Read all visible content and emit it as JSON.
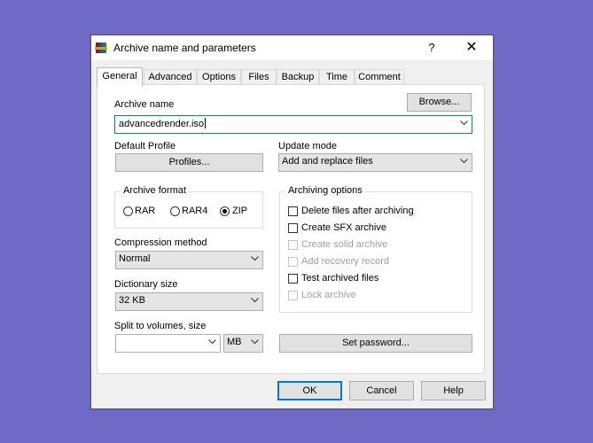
{
  "window": {
    "title": "Archive name and parameters",
    "help_label": "?",
    "close_label": "✕"
  },
  "tabs": [
    {
      "label": "General",
      "active": true
    },
    {
      "label": "Advanced",
      "active": false
    },
    {
      "label": "Options",
      "active": false
    },
    {
      "label": "Files",
      "active": false
    },
    {
      "label": "Backup",
      "active": false
    },
    {
      "label": "Time",
      "active": false
    },
    {
      "label": "Comment",
      "active": false
    }
  ],
  "general": {
    "archive_name_label": "Archive name",
    "browse_label": "Browse...",
    "archive_name_value": "advancedrender.iso",
    "default_profile_label": "Default Profile",
    "profiles_label": "Profiles...",
    "update_mode_label": "Update mode",
    "update_mode_value": "Add and replace files",
    "archive_format_label": "Archive format",
    "formats": [
      {
        "label": "RAR",
        "checked": false
      },
      {
        "label": "RAR4",
        "checked": false
      },
      {
        "label": "ZIP",
        "checked": true
      }
    ],
    "compression_method_label": "Compression method",
    "compression_method_value": "Normal",
    "dictionary_size_label": "Dictionary size",
    "dictionary_size_value": "32 KB",
    "split_label": "Split to volumes, size",
    "split_value": "",
    "split_unit_value": "MB",
    "archiving_options_label": "Archiving options",
    "options": [
      {
        "label": "Delete files after archiving",
        "checked": false,
        "enabled": true
      },
      {
        "label": "Create SFX archive",
        "checked": false,
        "enabled": true
      },
      {
        "label": "Create solid archive",
        "checked": false,
        "enabled": false
      },
      {
        "label": "Add recovery record",
        "checked": false,
        "enabled": false
      },
      {
        "label": "Test archived files",
        "checked": false,
        "enabled": true
      },
      {
        "label": "Lock archive",
        "checked": false,
        "enabled": false
      }
    ],
    "set_password_label": "Set password..."
  },
  "footer": {
    "ok_label": "OK",
    "cancel_label": "Cancel",
    "help_label": "Help"
  },
  "colors": {
    "desktop": "#6e6ac6",
    "focus_accent": "#0078d7"
  },
  "icons": {
    "app": "winrar-books-icon",
    "dropdown": "chevron-down-icon"
  }
}
